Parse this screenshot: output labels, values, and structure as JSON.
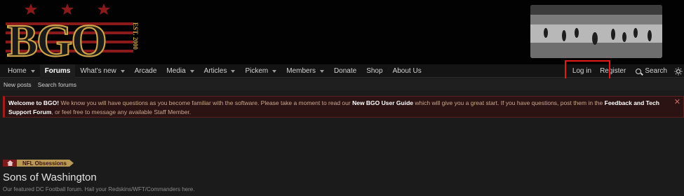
{
  "logo": {
    "text": "BGO",
    "est": "EST. 2000"
  },
  "nav": {
    "items": [
      {
        "label": "Home",
        "dropdown": true
      },
      {
        "label": "Forums",
        "dropdown": false,
        "active": true
      },
      {
        "label": "What's new",
        "dropdown": true
      },
      {
        "label": "Arcade",
        "dropdown": false
      },
      {
        "label": "Media",
        "dropdown": true
      },
      {
        "label": "Articles",
        "dropdown": true
      },
      {
        "label": "Pickem",
        "dropdown": true
      },
      {
        "label": "Members",
        "dropdown": true
      },
      {
        "label": "Donate",
        "dropdown": false
      },
      {
        "label": "Shop",
        "dropdown": false
      },
      {
        "label": "About Us",
        "dropdown": false
      }
    ],
    "login": "Log in",
    "register": "Register",
    "search": "Search",
    "theme_icon": "sun-icon"
  },
  "subnav": {
    "items": [
      "New posts",
      "Search forums"
    ]
  },
  "notice": {
    "welcome": "Welcome to BGO!",
    "text1": " We know you will have questions as you become familiar with the software. Please take a moment to read our ",
    "guide": "New BGO User Guide",
    "text2": " which will give you a great start. If you have questions, post them in the ",
    "support": "Feedback and Tech Support Forum",
    "text3": ", or feel free to message any available Staff Member.",
    "close": "✕"
  },
  "breadcrumb": {
    "label": "NFL Obsessions",
    "icon": "home-icon"
  },
  "page": {
    "title": "Sons of Washington",
    "description": "Our featured DC Football forum. Hail your Redskins/WFT/Commanders here."
  },
  "colors": {
    "accent": "#a01d1d",
    "gold": "#b99856",
    "highlight": "#e41b1b"
  }
}
